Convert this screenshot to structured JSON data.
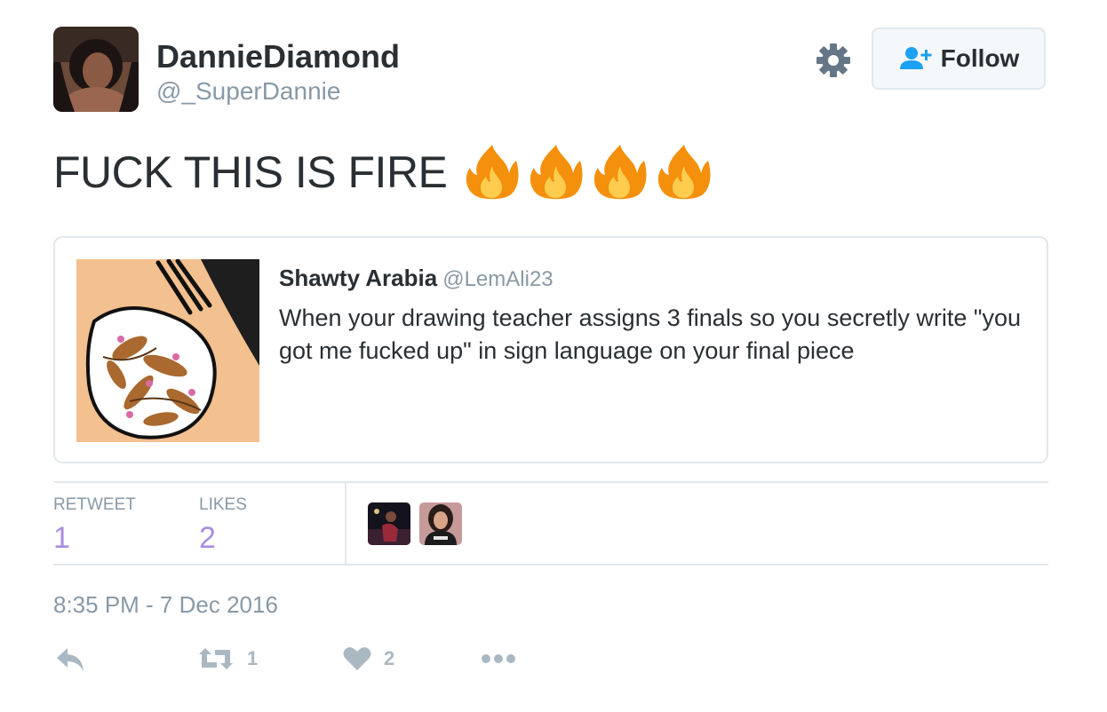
{
  "user": {
    "display_name": "DannieDiamond",
    "handle": "@_SuperDannie"
  },
  "follow_button": {
    "label": "Follow"
  },
  "tweet": {
    "text": "FUCK THIS IS FIRE",
    "emoji": [
      "fire-emoji",
      "fire-emoji",
      "fire-emoji",
      "fire-emoji"
    ]
  },
  "quoted_tweet": {
    "name": "Shawty Arabia",
    "handle": "@LemAli23",
    "text": "When your drawing teacher assigns 3 finals so you secretly write \"you got me fucked up\" in sign language on your final piece"
  },
  "stats": {
    "retweet_label": "RETWEET",
    "retweet_count": "1",
    "likes_label": "LIKES",
    "likes_count": "2"
  },
  "timestamp": "8:35 PM - 7 Dec 2016",
  "actions": {
    "retweet_count": "1",
    "like_count": "2"
  },
  "colors": {
    "text": "#292f33",
    "muted": "#8899a6",
    "stat_value": "#a98ddf",
    "follow_icon": "#1da1f2",
    "border": "#e1e8ed",
    "action_icon": "#aab8c2"
  }
}
